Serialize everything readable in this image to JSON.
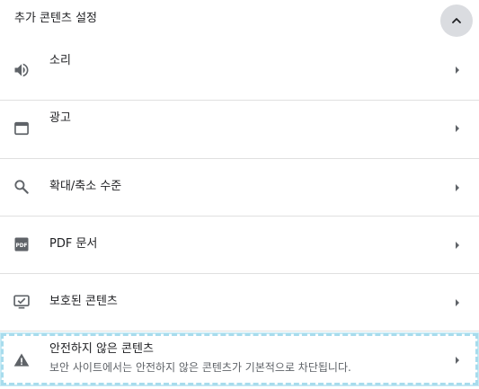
{
  "section": {
    "title": "추가 콘텐츠 설정"
  },
  "items": [
    {
      "label": "소리",
      "sublabel": ""
    },
    {
      "label": "광고",
      "sublabel": ""
    },
    {
      "label": "확대/축소 수준",
      "sublabel": ""
    },
    {
      "label": "PDF 문서",
      "sublabel": ""
    },
    {
      "label": "보호된 콘텐츠",
      "sublabel": ""
    },
    {
      "label": "안전하지 않은 콘텐츠",
      "sublabel": "보안 사이트에서는 안전하지 않은 콘텐츠가 기본적으로 차단됩니다."
    }
  ],
  "icons": {
    "collapse": "chevron-up-icon",
    "sound": "volume-icon",
    "ads": "window-icon",
    "zoom": "search-icon",
    "pdf": "pdf-icon",
    "protected": "protected-content-icon",
    "insecure": "warning-icon",
    "arrow": "arrow-right-icon"
  },
  "colors": {
    "icon": "#5f6368",
    "text": "#202124",
    "secondary_text": "#5f6368",
    "divider": "#e0e0e0",
    "collapse_bg": "#dadce0",
    "focus_ring": "#a8dced"
  }
}
